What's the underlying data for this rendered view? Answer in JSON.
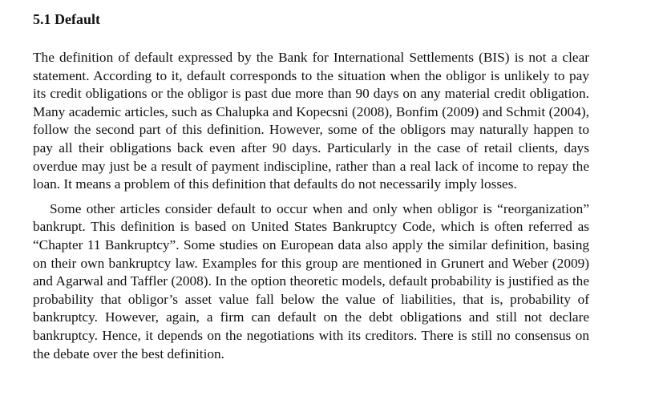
{
  "section": {
    "heading": "5.1 Default"
  },
  "paragraphs": [
    "The definition of default expressed by the Bank for International Settlements (BIS) is not a clear statement. According to it, default corresponds to the situation when the obligor is unlikely to pay its credit obligations or the obligor is past due more than 90 days on any material credit obligation. Many academic articles, such as Chalupka and Kopecsni (2008), Bonfim (2009) and Schmit (2004), follow the second part of this definition. However, some of the obligors may naturally happen to pay all their obligations back even after 90 days. Particularly in the case of retail clients, days overdue may just be a result of payment indiscipline, rather than a real lack of income to repay the loan. It means a problem of this definition that defaults do not necessarily imply losses.",
    "Some other articles consider default to occur when and only when obligor is “reorganization” bankrupt. This definition is based on United States Bankruptcy Code, which is often referred as “Chapter 11 Bankruptcy”. Some studies on European data also apply the similar definition, basing on their own bankruptcy law. Examples for this group are mentioned in Grunert and Weber (2009) and Agarwal and Taffler (2008). In the option theoretic models, default probability is justified as the probability that obligor’s asset value fall below the value of liabilities, that is, probability of bankruptcy. However, again, a firm can default on the debt obligations and still not declare bankruptcy. Hence, it depends on the negotiations with its creditors. There is still no consensus on the debate over the best definition."
  ]
}
